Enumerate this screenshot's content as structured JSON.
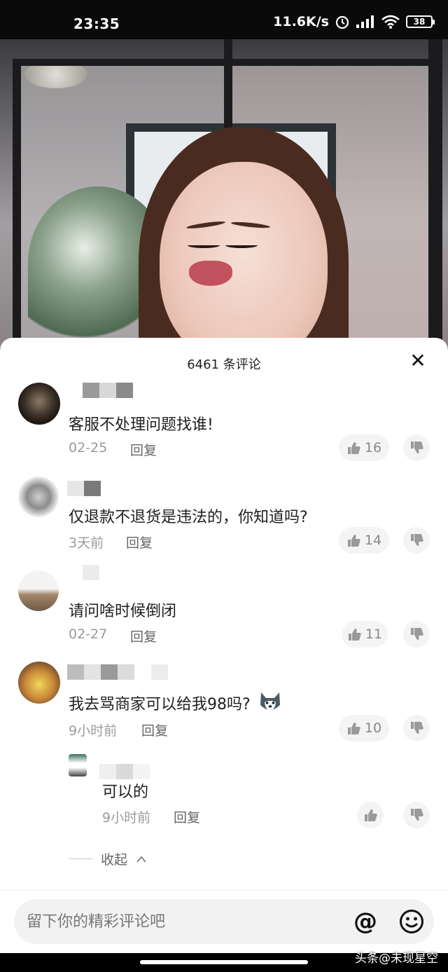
{
  "status_bar": {
    "time": "23:35",
    "net_speed": "11.6K/s",
    "battery": "38"
  },
  "comments_panel": {
    "title": "6461 条评论",
    "close_glyph": "✕",
    "comments": [
      {
        "text": "客服不处理问题找谁!",
        "date": "02-25",
        "reply_label": "回复",
        "likes": "16"
      },
      {
        "text": "仅退款不退货是违法的，你知道吗?",
        "date": "3天前",
        "reply_label": "回复",
        "likes": "14"
      },
      {
        "text": "请问啥时候倒闭",
        "date": "02-27",
        "reply_label": "回复",
        "likes": "11"
      },
      {
        "text": "我去骂商家可以给我98吗?",
        "date": "9小时前",
        "reply_label": "回复",
        "likes": "10"
      }
    ],
    "reply": {
      "text": "可以的",
      "date": "9小时前",
      "reply_label": "回复"
    },
    "collapse_label": "收起"
  },
  "input_bar": {
    "placeholder": "留下你的精彩评论吧",
    "at_glyph": "@"
  },
  "watermark": "头条@未现星空",
  "icons": [
    "close-icon",
    "thumbs-up-icon",
    "thumbs-down-icon",
    "at-icon",
    "emoji-icon",
    "chevron-up-icon",
    "wifi-icon",
    "signal-icon",
    "alarm-icon",
    "battery-icon",
    "husky-emoji-icon"
  ]
}
